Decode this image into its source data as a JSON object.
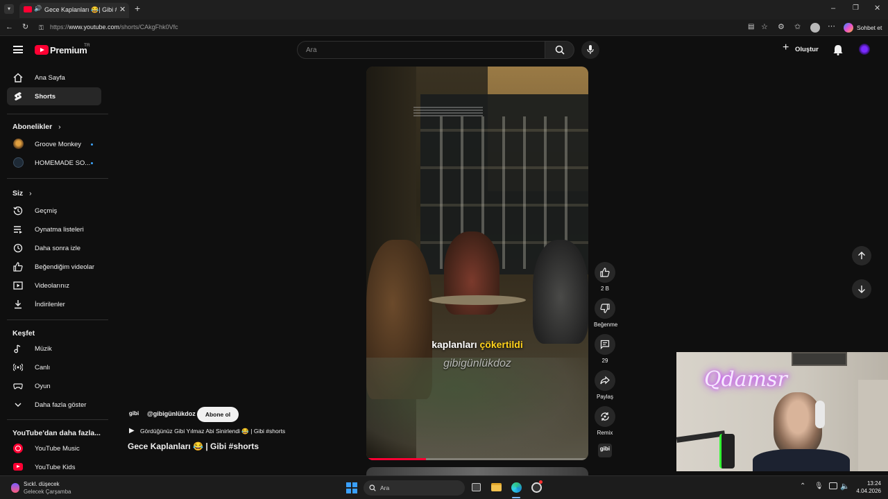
{
  "browser": {
    "tab_title": "Gece Kaplanları 😂| Gibi #sho",
    "url_prefix": "https://",
    "url_domain": "www.youtube.com",
    "url_path": "/shorts/CAkgFhk0Vfc",
    "copilot_label": "Sohbet et"
  },
  "header": {
    "logo_text": "Premium",
    "logo_region": "TR",
    "search_placeholder": "Ara",
    "create_label": "Oluştur"
  },
  "sidebar": {
    "main": [
      {
        "label": "Ana Sayfa",
        "icon": "home-icon"
      },
      {
        "label": "Shorts",
        "icon": "shorts-icon"
      }
    ],
    "subscriptions_heading": "Abonelikler",
    "subscriptions": [
      {
        "label": "Groove Monkey"
      },
      {
        "label": "HOMEMADE SO..."
      }
    ],
    "you_heading": "Siz",
    "you": [
      {
        "label": "Geçmiş",
        "icon": "history-icon"
      },
      {
        "label": "Oynatma listeleri",
        "icon": "playlist-icon"
      },
      {
        "label": "Daha sonra izle",
        "icon": "watch-later-icon"
      },
      {
        "label": "Beğendiğim videolar",
        "icon": "like-icon"
      },
      {
        "label": "Videolarınız",
        "icon": "your-videos-icon"
      },
      {
        "label": "İndirilenler",
        "icon": "download-icon"
      }
    ],
    "explore_heading": "Keşfet",
    "explore": [
      {
        "label": "Müzik",
        "icon": "music-icon"
      },
      {
        "label": "Canlı",
        "icon": "live-icon"
      },
      {
        "label": "Oyun",
        "icon": "gaming-icon"
      },
      {
        "label": "Daha fazla göster",
        "icon": "chevron-down-icon"
      }
    ],
    "more_heading": "YouTube'dan daha fazla...",
    "more": [
      {
        "label": "YouTube Music"
      },
      {
        "label": "YouTube Kids"
      }
    ]
  },
  "short": {
    "caption_line1": "kaplanları çökertildi",
    "caption_highlight": "çökertildi",
    "caption_line2": "gibigünlükdoz",
    "channel_handle": "@gibigünlükdoz",
    "channel_avatar_text": "gibi",
    "subscribe_label": "Abone ol",
    "linked_video": "Gördüğünüz Gibi Yılmaz Abi Sinirlendi 😂 | Gibi #shorts",
    "title": "Gece Kaplanları 😂 | Gibi #shorts",
    "progress_percent": 27,
    "actions": {
      "like_count": "2 B",
      "dislike_label": "Beğenme",
      "comment_count": "29",
      "share_label": "Paylaş",
      "remix_label": "Remix",
      "sound_badge": "gibi"
    }
  },
  "webcam": {
    "neon_sign": "Qdamsr"
  },
  "taskbar": {
    "weather_line1": "Sıckl. düşecek",
    "weather_line2": "Gelecek Çarşamba",
    "search_placeholder": "Ara",
    "time": "13:24",
    "date": "4.04.2026"
  },
  "colors": {
    "background": "#0f0f0f",
    "youtube_red": "#ff0033",
    "active_item": "#272727",
    "subscribe_bg": "#f1f1f1"
  }
}
